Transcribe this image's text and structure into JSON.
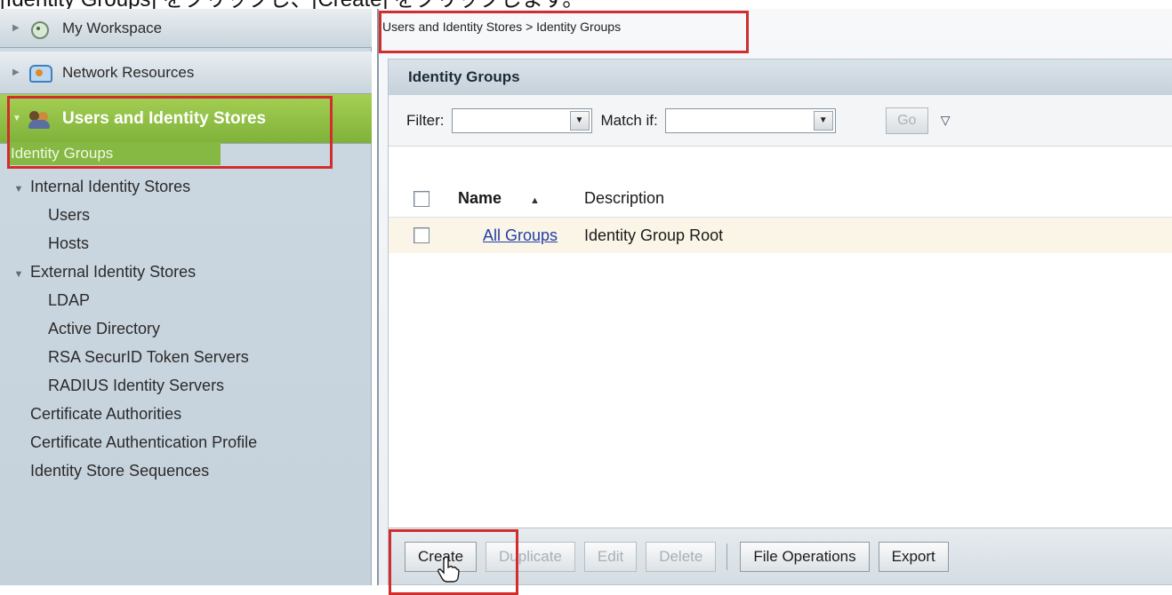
{
  "caption": "[Identity Groups] をクリックし、[Create] をクリックします。",
  "sidebar": {
    "drawers": [
      {
        "label": "My Workspace",
        "icon": "workspace-icon"
      },
      {
        "label": "Network Resources",
        "icon": "network-resources-icon"
      },
      {
        "label": "Users and Identity Stores",
        "icon": "users-icon"
      }
    ],
    "selected": "Identity Groups",
    "items": [
      {
        "label": "Internal Identity Stores",
        "level": 1,
        "expanded": true
      },
      {
        "label": "Users",
        "level": 2
      },
      {
        "label": "Hosts",
        "level": 2
      },
      {
        "label": "External Identity Stores",
        "level": 1,
        "expanded": true
      },
      {
        "label": "LDAP",
        "level": 2
      },
      {
        "label": "Active Directory",
        "level": 2
      },
      {
        "label": "RSA SecurID Token Servers",
        "level": 2
      },
      {
        "label": "RADIUS Identity Servers",
        "level": 2
      },
      {
        "label": "Certificate Authorities",
        "level": 1
      },
      {
        "label": "Certificate Authentication Profile",
        "level": 1
      },
      {
        "label": "Identity Store Sequences",
        "level": 1
      }
    ]
  },
  "breadcrumb": "Users and Identity Stores > Identity Groups",
  "panel": {
    "title": "Identity Groups",
    "filter_label": "Filter:",
    "match_label": "Match if:",
    "go_label": "Go",
    "columns": {
      "name": "Name",
      "description": "Description"
    },
    "rows": [
      {
        "name": "All Groups",
        "description": "Identity Group Root"
      }
    ]
  },
  "actions": {
    "create": "Create",
    "duplicate": "Duplicate",
    "edit": "Edit",
    "delete": "Delete",
    "file_operations": "File Operations",
    "export": "Export"
  },
  "colors": {
    "highlight_box": "#d22d2d",
    "selected_drawer": "#8cbf45",
    "link": "#2140a8"
  }
}
